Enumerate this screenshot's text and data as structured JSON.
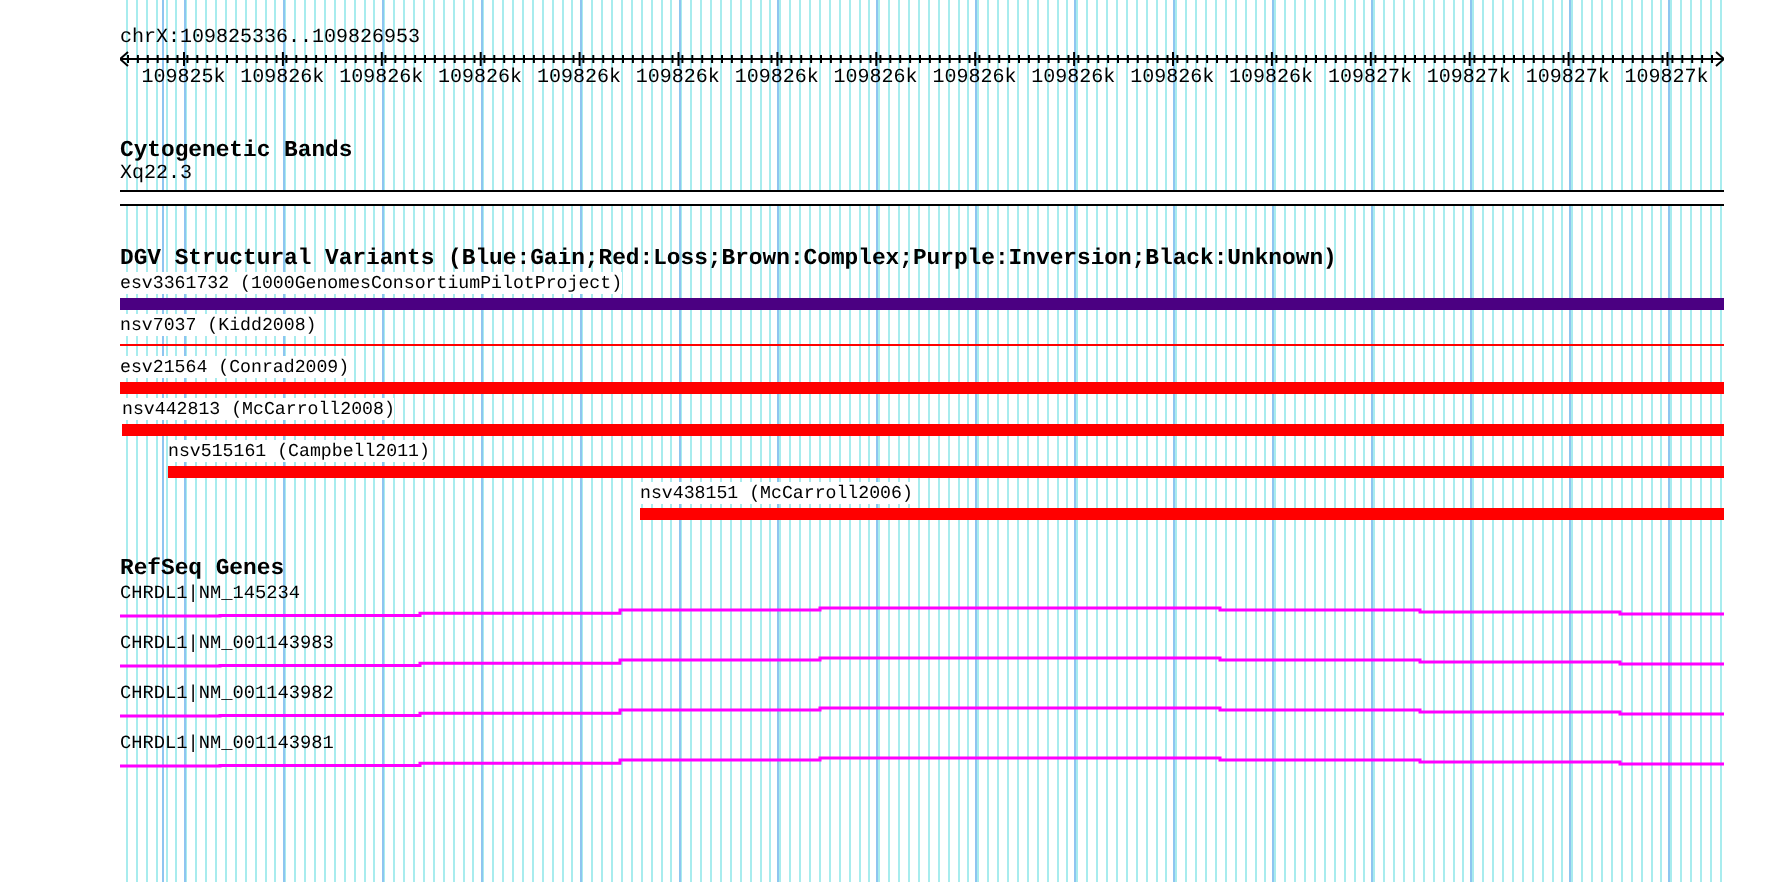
{
  "location": "chrX:109825336..109826953",
  "ruler": {
    "tick_labels": [
      "109825k",
      "109826k",
      "109826k",
      "109826k",
      "109826k",
      "109826k",
      "109826k",
      "109826k",
      "109826k",
      "109826k",
      "109826k",
      "109826k",
      "109827k",
      "109827k",
      "109827k",
      "109827k"
    ]
  },
  "tracks": [
    {
      "kind": "cytoband",
      "title": "Cytogenetic Bands",
      "band": "Xq22.3"
    },
    {
      "kind": "variants",
      "title": "DGV Structural Variants (Blue:Gain;Red:Loss;Brown:Complex;Purple:Inversion;Black:Unknown)",
      "features": [
        {
          "label": "esv3361732 (1000GenomesConsortiumPilotProject)",
          "color": "#4b0082"
        },
        {
          "label": "nsv7037 (Kidd2008)",
          "color": "#ff0000"
        },
        {
          "label": "esv21564 (Conrad2009)",
          "color": "#ff0000"
        },
        {
          "label": "nsv442813 (McCarroll2008)",
          "color": "#ff0000"
        },
        {
          "label": "nsv515161 (Campbell2011)",
          "color": "#ff0000"
        },
        {
          "label": "nsv438151 (McCarroll2006)",
          "color": "#ff0000"
        }
      ]
    },
    {
      "kind": "genes",
      "title": "RefSeq Genes",
      "features": [
        {
          "label": "CHRDL1|NM_145234"
        },
        {
          "label": "CHRDL1|NM_001143983"
        },
        {
          "label": "CHRDL1|NM_001143982"
        },
        {
          "label": "CHRDL1|NM_001143981"
        }
      ]
    }
  ]
}
